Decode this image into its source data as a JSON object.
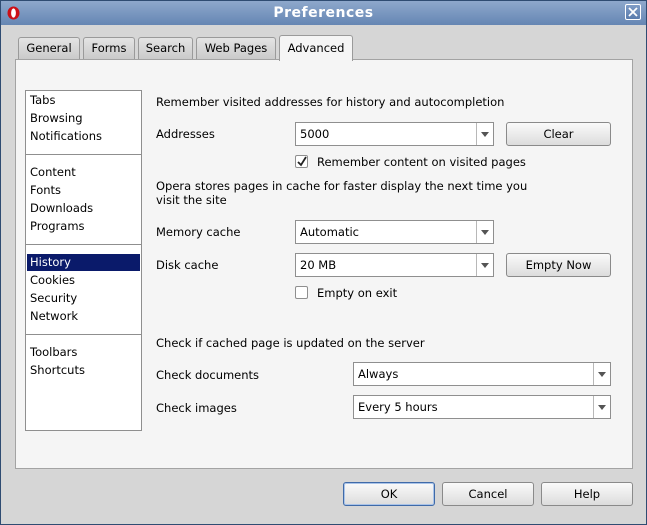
{
  "window": {
    "title": "Preferences"
  },
  "tabs": [
    {
      "label": "General"
    },
    {
      "label": "Forms"
    },
    {
      "label": "Search"
    },
    {
      "label": "Web Pages"
    },
    {
      "label": "Advanced",
      "active": true
    }
  ],
  "sidebar": {
    "groups": [
      [
        "Tabs",
        "Browsing",
        "Notifications"
      ],
      [
        "Content",
        "Fonts",
        "Downloads",
        "Programs"
      ],
      [
        "History",
        "Cookies",
        "Security",
        "Network"
      ],
      [
        "Toolbars",
        "Shortcuts"
      ]
    ],
    "selected": "History"
  },
  "history": {
    "remember_heading": "Remember visited addresses for history and autocompletion",
    "addresses_label": "Addresses",
    "addresses_value": "5000",
    "clear_label": "Clear",
    "remember_content_label": "Remember content on visited pages",
    "remember_content_checked": true,
    "cache_heading": "Opera stores pages in cache for faster display the next time you visit the site",
    "memory_cache_label": "Memory cache",
    "memory_cache_value": "Automatic",
    "disk_cache_label": "Disk cache",
    "disk_cache_value": "20 MB",
    "empty_now_label": "Empty Now",
    "empty_on_exit_label": "Empty on exit",
    "empty_on_exit_checked": false,
    "check_heading": "Check if cached page is updated on the server",
    "check_documents_label": "Check documents",
    "check_documents_value": "Always",
    "check_images_label": "Check images",
    "check_images_value": "Every 5 hours"
  },
  "footer": {
    "ok_label": "OK",
    "cancel_label": "Cancel",
    "help_label": "Help"
  },
  "colors": {
    "title_bar": "#6f8fbb",
    "selection": "#0a1a6a",
    "opera_red": "#cc0f16"
  }
}
